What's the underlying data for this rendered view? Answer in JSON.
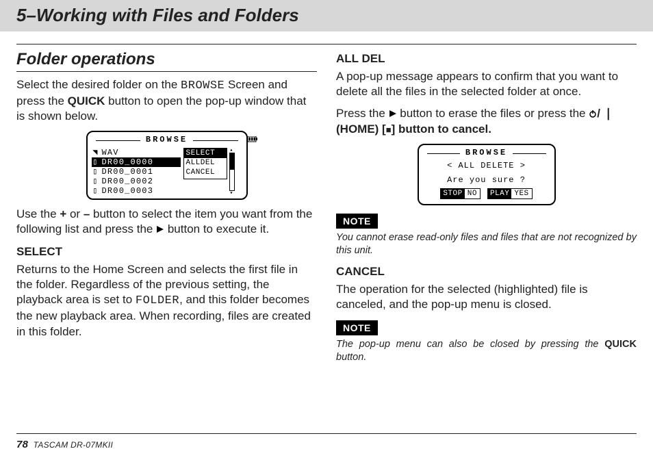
{
  "chapter": {
    "title": "5–Working with Files and Folders"
  },
  "col1": {
    "section_title": "Folder operations",
    "para1_pre": "Select the desired folder on the ",
    "para1_browse": "BROWSE",
    "para1_mid": " Screen and press the ",
    "para1_quick": "QUICK",
    "para1_post": " button to open the pop-up window that is shown below.",
    "fig1": {
      "title": "BROWSE",
      "rows": [
        {
          "icon": "folder-open",
          "name": "WAV",
          "hl": false
        },
        {
          "icon": "file",
          "name": "DR00_0000",
          "hl": true
        },
        {
          "icon": "file",
          "name": "DR00_0001",
          "hl": false
        },
        {
          "icon": "file",
          "name": "DR00_0002",
          "hl": false
        },
        {
          "icon": "file",
          "name": "DR00_0003",
          "hl": false
        }
      ],
      "menu": [
        {
          "label": "SELECT",
          "sel": true
        },
        {
          "label": "ALLDEL",
          "sel": false
        },
        {
          "label": "CANCEL",
          "sel": false
        }
      ]
    },
    "para2_pre": "Use the ",
    "para2_plus": "+",
    "para2_mid1": " or ",
    "para2_minus": "–",
    "para2_mid2": " button to select the item you want from the following list and press the ",
    "para2_post": " button to execute it.",
    "select_heading": "SELECT",
    "select_para_pre": "Returns to the Home Screen and selects the first file in the folder. Regardless of the previous setting, the playback area is set to ",
    "select_para_folder": "FOLDER",
    "select_para_post": ", and this folder becomes the new playback area. When recording, files are created in this folder."
  },
  "col2": {
    "alldel_heading": "ALL DEL",
    "alldel_para": "A pop-up message appears to confirm that you want to delete all the files in the selected folder at once.",
    "press_pre": "Press the ",
    "press_mid": " button to erase the files or press the ",
    "press_home_open": " (",
    "press_home": "HOME",
    "press_home_close": ") [",
    "press_close": "] button to cancel.",
    "fig2": {
      "title": "BROWSE",
      "head": "< ALL DELETE >",
      "msg": "Are you sure ?",
      "btn_stop_k": "STOP",
      "btn_stop_v": "NO",
      "btn_play_k": "PLAY",
      "btn_play_v": "YES"
    },
    "note1_label": "NOTE",
    "note1_text": "You cannot erase read-only files and files that are not recognized by this unit.",
    "cancel_heading": "CANCEL",
    "cancel_para": "The operation for the selected (highlighted) file is canceled, and the pop-up menu is closed.",
    "note2_label": "NOTE",
    "note2_text_pre": "The pop-up menu can also be closed by pressing the ",
    "note2_quick": "QUICK",
    "note2_text_post": " button."
  },
  "footer": {
    "page": "78",
    "model": "TASCAM DR-07MKII"
  }
}
